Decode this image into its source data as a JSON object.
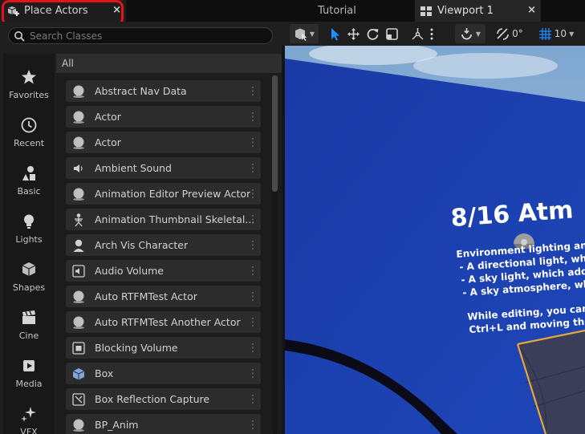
{
  "tabs": {
    "place_actors": "Place Actors",
    "tutorial": "Tutorial",
    "viewport": "Viewport 1",
    "close_glyph": "×"
  },
  "search": {
    "placeholder": "Search Classes"
  },
  "categories": [
    {
      "label": "Favorites",
      "icon": "star-icon"
    },
    {
      "label": "Recent",
      "icon": "clock-icon"
    },
    {
      "label": "Basic",
      "icon": "shapes-basic-icon"
    },
    {
      "label": "Lights",
      "icon": "lightbulb-icon"
    },
    {
      "label": "Shapes",
      "icon": "cube-shapes-icon"
    },
    {
      "label": "Cine",
      "icon": "clapper-icon"
    },
    {
      "label": "Media",
      "icon": "media-icon"
    },
    {
      "label": "VFX",
      "icon": "sparkle-icon"
    }
  ],
  "list": {
    "header": "All",
    "items": [
      {
        "label": "Abstract Nav Data",
        "icon": "sphere-icon"
      },
      {
        "label": "Actor",
        "icon": "sphere-icon"
      },
      {
        "label": "Actor",
        "icon": "sphere-icon"
      },
      {
        "label": "Ambient Sound",
        "icon": "speaker-icon"
      },
      {
        "label": "Animation Editor Preview Actor",
        "icon": "sphere-icon"
      },
      {
        "label": "Animation Thumbnail Skeletal...",
        "icon": "skeleton-icon"
      },
      {
        "label": "Arch Vis Character",
        "icon": "character-icon"
      },
      {
        "label": "Audio Volume",
        "icon": "audio-volume-icon"
      },
      {
        "label": "Auto RTFMTest Actor",
        "icon": "sphere-icon"
      },
      {
        "label": "Auto RTFMTest Another Actor",
        "icon": "sphere-icon"
      },
      {
        "label": "Blocking Volume",
        "icon": "blocking-volume-icon"
      },
      {
        "label": "Box",
        "icon": "box-icon"
      },
      {
        "label": "Box Reflection Capture",
        "icon": "reflection-capture-icon"
      },
      {
        "label": "BP_Anim",
        "icon": "sphere-icon"
      }
    ]
  },
  "toolbar": {
    "rotation_snap_value": "0°",
    "grid_snap_value": "10"
  },
  "viewport_scene": {
    "title": "8/16 Atm",
    "lines": [
      "Environment lighting and",
      "- A directional light, whic",
      "- A sky light, which adds",
      "- A sky atmosphere, whi",
      "While editing, you can c",
      "Ctrl+L and moving the m"
    ],
    "colors": {
      "wall": "#1b3ca8",
      "sky": "#8fb4d8",
      "selection": "#e8a53a"
    }
  }
}
